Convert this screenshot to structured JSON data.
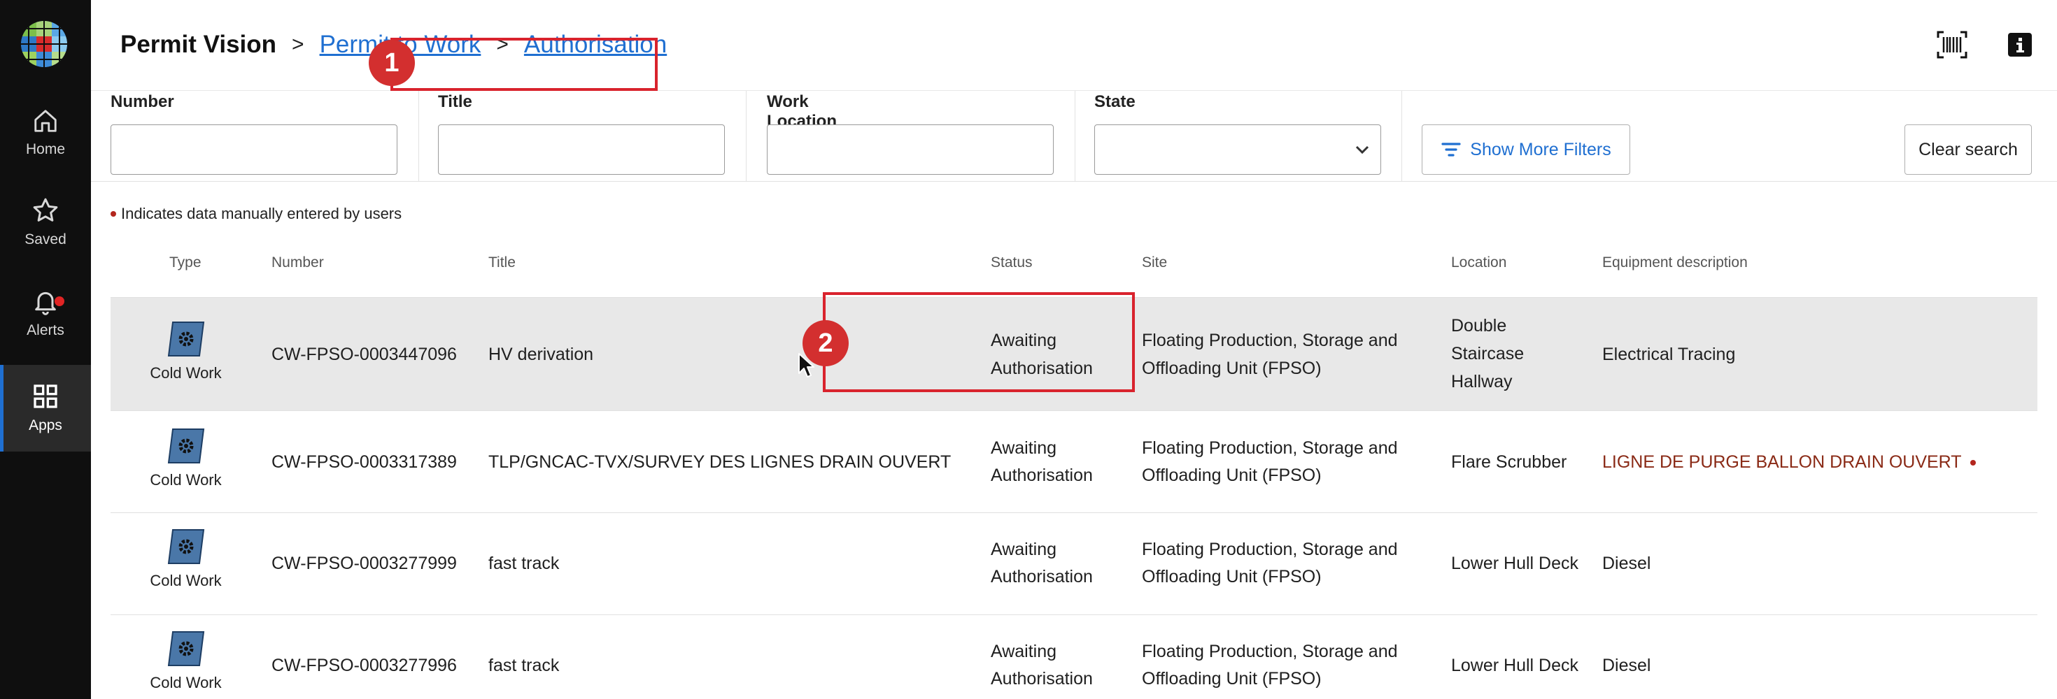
{
  "sidebar": {
    "items": [
      {
        "label": "Home",
        "icon": "home-icon"
      },
      {
        "label": "Saved",
        "icon": "star-icon"
      },
      {
        "label": "Alerts",
        "icon": "bell-icon"
      },
      {
        "label": "Apps",
        "icon": "grid-icon"
      }
    ],
    "active": "Apps",
    "accent": "#1f6fd1"
  },
  "header": {
    "title": "Permit Vision",
    "crumb_1": "Permit to Work",
    "crumb_2": "Authorisation",
    "sep": ">"
  },
  "filters": {
    "number_label": "Number",
    "title_label": "Title",
    "location_label": "Work Location",
    "state_label": "State",
    "number_value": "",
    "title_value": "",
    "location_value": "",
    "state_value": "",
    "more_label": "Show More Filters",
    "clear_label": "Clear search"
  },
  "note": "Indicates data manually entered by users",
  "table": {
    "columns": {
      "type": "Type",
      "number": "Number",
      "title": "Title",
      "status": "Status",
      "site": "Site",
      "location": "Location",
      "equipment": "Equipment description"
    },
    "rows": [
      {
        "type": "Cold Work",
        "number": "CW-FPSO-0003447096",
        "title": "HV derivation",
        "status_1": "Awaiting",
        "status_2": "Authorisation",
        "site_1": "Floating Production, Storage and",
        "site_2": "Offloading Unit (FPSO)",
        "location_1": "Double",
        "location_2": "Staircase",
        "location_3": "Hallway",
        "equipment": "Electrical Tracing"
      },
      {
        "type": "Cold Work",
        "number": "CW-FPSO-0003317389",
        "title": "TLP/GNCAC-TVX/SURVEY DES LIGNES DRAIN OUVERT",
        "status_1": "Awaiting",
        "status_2": "Authorisation",
        "site_1": "Floating Production, Storage and",
        "site_2": "Offloading Unit (FPSO)",
        "location_1": "Flare Scrubber",
        "equipment": "LIGNE DE PURGE BALLON DRAIN OUVERT"
      },
      {
        "type": "Cold Work",
        "number": "CW-FPSO-0003277999",
        "title": "fast track",
        "status_1": "Awaiting",
        "status_2": "Authorisation",
        "site_1": "Floating Production, Storage and",
        "site_2": "Offloading Unit (FPSO)",
        "location_1": "Lower Hull Deck",
        "equipment": "Diesel"
      },
      {
        "type": "Cold Work",
        "number": "CW-FPSO-0003277996",
        "title": "fast track",
        "status_1": "Awaiting",
        "status_2": "Authorisation",
        "site_1": "Floating Production, Storage and",
        "site_2": "Offloading Unit (FPSO)",
        "location_1": "Lower Hull Deck",
        "equipment": "Diesel"
      }
    ]
  },
  "annotations": {
    "badge_1": "1",
    "badge_2": "2",
    "color": "#d9232d"
  }
}
